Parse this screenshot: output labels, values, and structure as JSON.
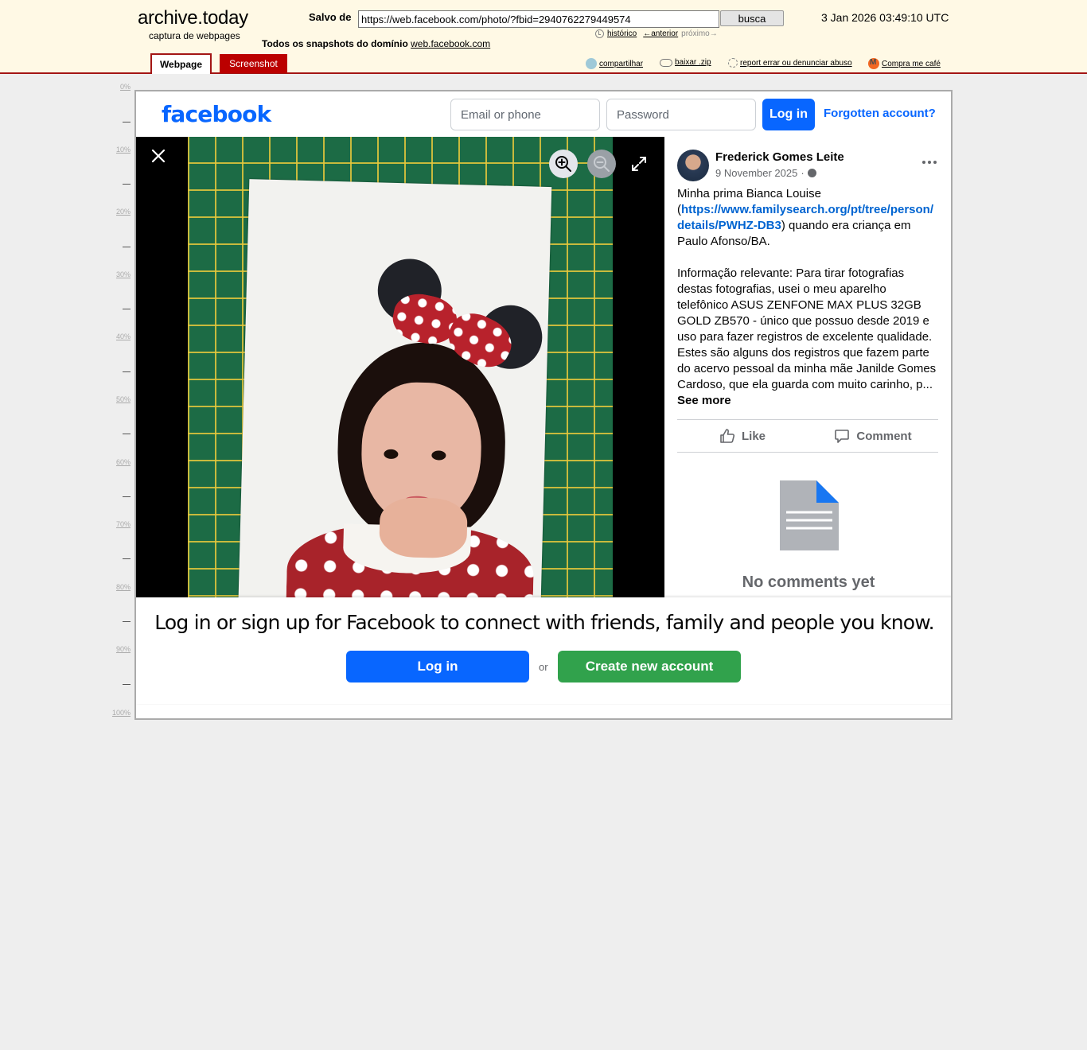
{
  "archive": {
    "logo": "archive.today",
    "subtitle": "captura de webpages",
    "saved_from_label": "Salvo de",
    "url": "https://web.facebook.com/photo/?fbid=2940762279449574",
    "search_label": "busca",
    "date": "3 Jan 2026 03:49:10 UTC",
    "history_label": "histórico",
    "prev_label": "←anterior",
    "next_label": "próximo→",
    "all_snapshots_label": "Todos os snapshots  do domínio",
    "domain_link": "web.facebook.com",
    "tabs": {
      "webpage": "Webpage",
      "screenshot": "Screenshot"
    },
    "tools": {
      "share": "compartilhar",
      "download": "baixar .zip",
      "report": "report errar ou denunciar abuso",
      "coffee": "Compra me café"
    },
    "ruler": [
      "0%",
      "10%",
      "20%",
      "30%",
      "40%",
      "50%",
      "60%",
      "70%",
      "80%",
      "90%",
      "100%"
    ]
  },
  "facebook": {
    "logo": "facebook",
    "email_placeholder": "Email or phone",
    "password_placeholder": "Password",
    "login_label": "Log in",
    "forgot_label": "Forgotten account?",
    "post": {
      "author": "Frederick Gomes Leite",
      "date": "9 November 2025",
      "visibility_separator": "·",
      "caption_part1": "Minha prima Bianca Louise (",
      "caption_link": "https://www.familysearch.org/pt/tree/person/details/PWHZ-DB3",
      "caption_part2": ") quando era criança em Paulo Afonso/BA.",
      "caption_part3": "Informação relevante: Para tirar fotografias destas fotografias, usei o meu aparelho telefônico ASUS ZENFONE MAX PLUS 32GB GOLD ZB570 - único que possuo desde 2019 e uso para fazer registros de excelente qualidade. Estes são alguns dos registros que fazem parte do acervo pessoal da minha mãe Janilde Gomes Cardoso, que ela guarda com muito carinho, p...",
      "see_more": "See more",
      "like_label": "Like",
      "comment_label": "Comment",
      "no_comments": "No comments yet"
    },
    "bottom": {
      "title": "Log in or sign up for Facebook to connect with friends, family and people you know.",
      "login_label": "Log in",
      "or_label": "or",
      "create_label": "Create new account"
    }
  },
  "colors": {
    "archive_bg": "#fff9e5",
    "archive_accent": "#a31515",
    "fb_blue": "#0866ff",
    "fb_green": "#31a24c"
  }
}
